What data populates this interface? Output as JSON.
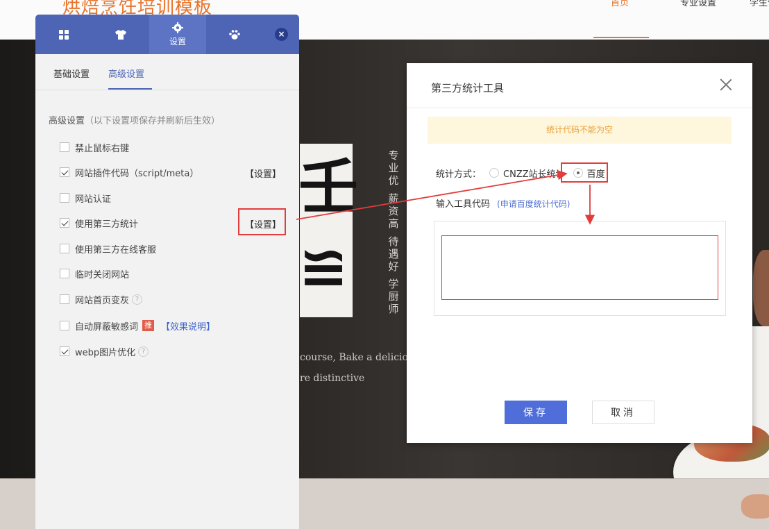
{
  "site": {
    "logo": "烘焙烹饪培训模板",
    "nav": [
      "首页",
      "专业设置",
      "学生作"
    ],
    "hero_vertical_1": "专业优",
    "hero_vertical_2": "薪资高",
    "hero_vertical_3": "待遇好",
    "hero_vertical_4": "学厨师",
    "hero_line_1": "course,   Bake a deliciou",
    "hero_line_2": "re distinctive",
    "brand_glyph_1": "壬",
    "brand_glyph_2": "≌"
  },
  "panel": {
    "tabs": [
      {
        "icon": "grid-icon",
        "label": ""
      },
      {
        "icon": "shirt-icon",
        "label": ""
      },
      {
        "icon": "gear-icon",
        "label": "设置"
      },
      {
        "icon": "paw-icon",
        "label": ""
      }
    ],
    "close_label": "×",
    "subtabs": [
      "基础设置",
      "高级设置"
    ],
    "section_title": "高级设置",
    "section_hint": "（以下设置项保存并刷新后生效）",
    "options": [
      {
        "label": "禁止鼠标右键",
        "checked": false
      },
      {
        "label": "网站插件代码（script/meta）",
        "checked": true,
        "action": "【设置】"
      },
      {
        "label": "网站认证",
        "checked": false
      },
      {
        "label": "使用第三方统计",
        "checked": true,
        "action": "【设置】"
      },
      {
        "label": "使用第三方在线客服",
        "checked": false
      },
      {
        "label": "临时关闭网站",
        "checked": false
      },
      {
        "label": "网站首页变灰",
        "checked": false,
        "help": "?"
      },
      {
        "label": "自动屏蔽敏感词",
        "checked": false,
        "badge": "推",
        "link": "【效果说明】"
      },
      {
        "label": "webp图片优化",
        "checked": true,
        "help": "?"
      }
    ]
  },
  "modal": {
    "title": "第三方统计工具",
    "alert": "统计代码不能为空",
    "method_label": "统计方式：",
    "methods": [
      {
        "label": "CNZZ站长统计",
        "selected": false
      },
      {
        "label": "百度",
        "selected": true
      }
    ],
    "code_label": "输入工具代码",
    "code_link": "(申请百度统计代码)",
    "code_value": "",
    "save_label": "保存",
    "cancel_label": "取消"
  },
  "colors": {
    "panel_header": "#4e65b6",
    "accent_orange": "#e8742a",
    "highlight_red": "#e23c3c",
    "save_button": "#4f6ed9",
    "alert_bg": "#fff6de",
    "alert_text": "#e8a036"
  }
}
